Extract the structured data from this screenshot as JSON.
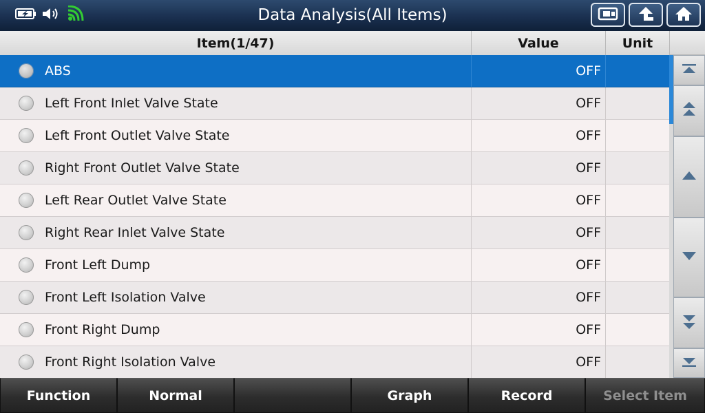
{
  "window": {
    "title": "Data Analysis(All Items)"
  },
  "status_icons": {
    "battery": "battery-charging-icon",
    "volume": "speaker-icon",
    "wifi": "wifi-icon",
    "wifi_color": "#33cc33"
  },
  "top_buttons": [
    "screenshot-icon",
    "back-up-arrow-icon",
    "home-icon"
  ],
  "table": {
    "headers": {
      "item": "Item(1/47)",
      "value": "Value",
      "unit": "Unit"
    },
    "rows": [
      {
        "item": "ABS",
        "value": "OFF",
        "unit": ""
      },
      {
        "item": "Left Front Inlet Valve State",
        "value": "OFF",
        "unit": ""
      },
      {
        "item": "Left Front Outlet Valve State",
        "value": "OFF",
        "unit": ""
      },
      {
        "item": "Right Front Outlet Valve State",
        "value": "OFF",
        "unit": ""
      },
      {
        "item": "Left Rear Outlet Valve State",
        "value": "OFF",
        "unit": ""
      },
      {
        "item": "Right Rear Inlet Valve State",
        "value": "OFF",
        "unit": ""
      },
      {
        "item": "Front Left Dump",
        "value": "OFF",
        "unit": ""
      },
      {
        "item": "Front Left Isolation Valve",
        "value": "OFF",
        "unit": ""
      },
      {
        "item": "Front Right Dump",
        "value": "OFF",
        "unit": ""
      },
      {
        "item": "Front Right Isolation Valve",
        "value": "OFF",
        "unit": ""
      }
    ],
    "selected_index": 0,
    "selected_color": "#0e6fc5"
  },
  "scroll_buttons": [
    "scroll-top-icon",
    "page-up-icon",
    "scroll-up-icon",
    "scroll-down-icon",
    "page-down-icon",
    "scroll-bottom-icon"
  ],
  "bottom_toolbar": {
    "buttons": [
      {
        "label": "Function",
        "enabled": true
      },
      {
        "label": "Normal",
        "enabled": true
      },
      {
        "label": "",
        "enabled": true
      },
      {
        "label": "Graph",
        "enabled": true
      },
      {
        "label": "Record",
        "enabled": true
      },
      {
        "label": "Select Item",
        "enabled": false
      }
    ]
  }
}
